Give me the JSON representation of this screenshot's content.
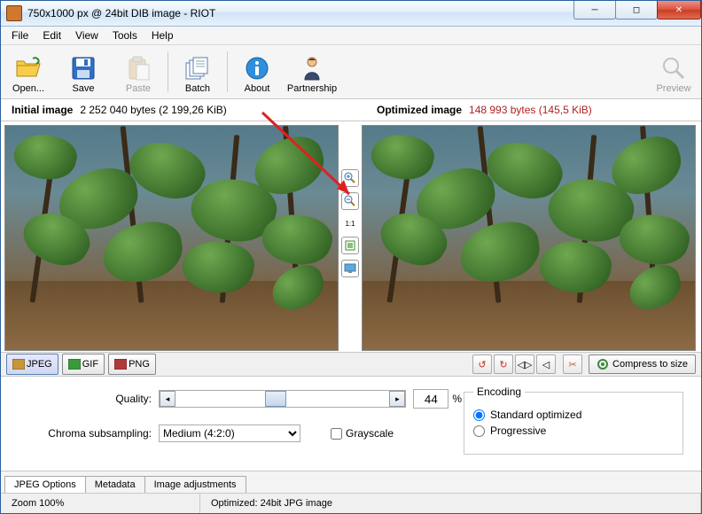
{
  "window": {
    "title": "750x1000 px @ 24bit  DIB image - RIOT"
  },
  "menu": {
    "file": "File",
    "edit": "Edit",
    "view": "View",
    "tools": "Tools",
    "help": "Help"
  },
  "toolbar": {
    "open": "Open...",
    "save": "Save",
    "paste": "Paste",
    "batch": "Batch",
    "about": "About",
    "partnership": "Partnership",
    "preview": "Preview"
  },
  "info": {
    "initial_label": "Initial image",
    "initial_bytes": "2 252 040 bytes (2 199,26 KiB)",
    "optimized_label": "Optimized image",
    "optimized_bytes": "148 993 bytes (145,5 KiB)"
  },
  "midtools": {
    "onetoone": "1:1"
  },
  "formats": {
    "jpeg": "JPEG",
    "gif": "GIF",
    "png": "PNG",
    "compress": "Compress to size"
  },
  "settings": {
    "quality_label": "Quality:",
    "quality_value": "44",
    "percent": "%",
    "chroma_label": "Chroma subsampling:",
    "chroma_value": "Medium (4:2:0)",
    "grayscale": "Grayscale",
    "encoding_legend": "Encoding",
    "standard": "Standard optimized",
    "progressive": "Progressive"
  },
  "tabs": {
    "jpeg_options": "JPEG Options",
    "metadata": "Metadata",
    "image_adj": "Image adjustments"
  },
  "status": {
    "zoom": "Zoom 100%",
    "optimized": "Optimized: 24bit JPG image"
  }
}
